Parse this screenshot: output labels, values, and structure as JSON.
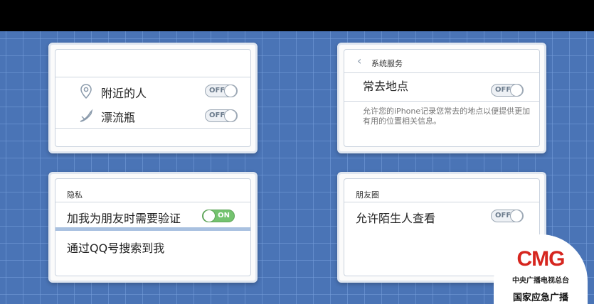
{
  "panel_nearby": {
    "nearby_people": {
      "label": "附近的人",
      "toggle": "OFF"
    },
    "drift_bottle": {
      "label": "漂流瓶",
      "toggle": "OFF"
    }
  },
  "panel_system": {
    "back_title": "系统服务",
    "frequent_places": {
      "label": "常去地点",
      "toggle": "OFF"
    },
    "note": "允许您的iPhone记录您常去的地点以便提供更加有用的位置相关信息。"
  },
  "panel_privacy": {
    "header": "隐私",
    "verify": {
      "label": "加我为朋友时需要验证",
      "toggle": "ON"
    },
    "qq_search": {
      "label": "通过QQ号搜索到我"
    }
  },
  "panel_moments": {
    "header": "朋友圈",
    "strangers": {
      "label": "允许陌生人查看",
      "toggle": "OFF"
    }
  },
  "logo": {
    "brand": "CMG",
    "line1": "中央广播电视总台",
    "line2": "国家应急广播"
  },
  "colors": {
    "background": "#4a74b6",
    "toggle_on": "#74c36f",
    "logo_red": "#d6261f"
  }
}
